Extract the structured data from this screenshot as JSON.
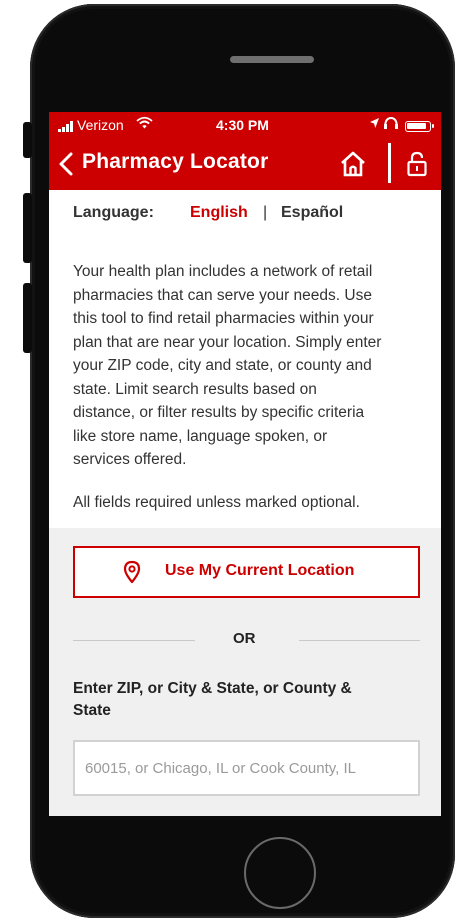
{
  "status_bar": {
    "carrier": "Verizon",
    "time": "4:30 PM"
  },
  "header": {
    "title": "Pharmacy Locator",
    "back_icon": "chevron-left-icon",
    "home_icon": "home-icon",
    "lock_icon": "lock-icon",
    "background_color": "#cc0000"
  },
  "language": {
    "label": "Language:",
    "selected": "English",
    "separator": "|",
    "other": "Español",
    "accent_color": "#cc0000"
  },
  "intro": {
    "lines": [
      "Your health plan includes a network of retail",
      "pharmacies that can serve your needs. Use",
      "this tool to find retail pharmacies within your",
      "plan that are near your location. Simply enter",
      "your ZIP code, city and state, or county and",
      "state. Limit search results based on",
      "distance, or filter results by specific criteria",
      "like store name, language spoken, or",
      "services offered."
    ],
    "required_note": "All fields required unless marked optional."
  },
  "form": {
    "use_location_label": "Use My Current Location",
    "use_location_icon": "location-pin-icon",
    "or_label": "OR",
    "zip_label_lines": [
      "Enter ZIP, or City & State, or County &",
      "State"
    ],
    "zip_input_value": "",
    "zip_input_placeholder": "60015, or Chicago, IL or Cook County, IL"
  }
}
